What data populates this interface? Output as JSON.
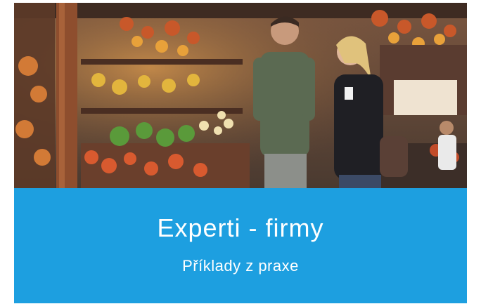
{
  "hero": {
    "alt": "Couple walking past a market stall"
  },
  "banner": {
    "title": "Experti - firmy",
    "subtitle": "Příklady z praxe",
    "background": "#1d9fe0",
    "text_color": "#ffffff"
  }
}
